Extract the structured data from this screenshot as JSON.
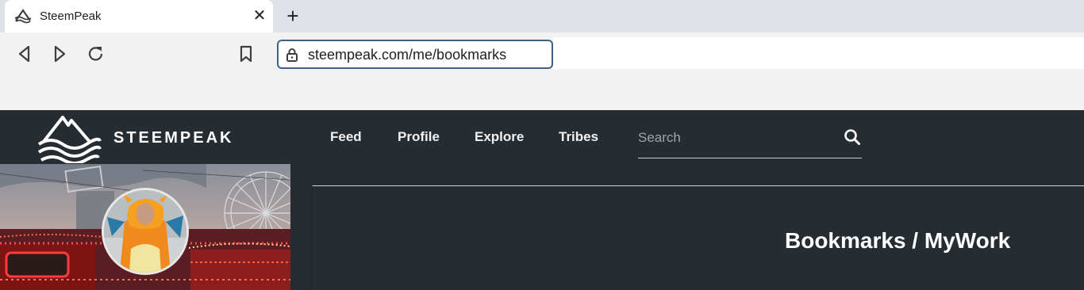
{
  "browser": {
    "tab": {
      "title": "SteemPeak",
      "close_glyph": "✕",
      "favicon": "steempeak-mountain-icon"
    },
    "new_tab_glyph": "+",
    "toolbar": {
      "back_icon": "back-icon",
      "forward_icon": "forward-icon",
      "reload_icon": "reload-icon",
      "bookmark_icon": "bookmark-icon"
    },
    "address": {
      "url": "steempeak.com/me/bookmarks",
      "icon": "lock-icon"
    }
  },
  "site": {
    "logo_text": "STEEMPEAK",
    "nav": [
      {
        "label": "Feed"
      },
      {
        "label": "Profile"
      },
      {
        "label": "Explore"
      },
      {
        "label": "Tribes"
      }
    ],
    "search": {
      "placeholder": "Search",
      "icon": "search-icon"
    },
    "page_title": "Bookmarks / MyWork"
  },
  "colors": {
    "tabstrip_bg": "#dee1e6",
    "toolbar_bg": "#f2f2f2",
    "site_bg": "#252d33",
    "omnibox_border": "#3f6189",
    "text_light": "#ffffff"
  }
}
